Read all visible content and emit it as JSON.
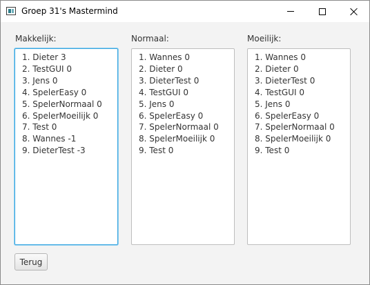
{
  "window": {
    "title": "Groep 31's Mastermind"
  },
  "columns": [
    {
      "label": "Makkelijk:",
      "entries": [
        "1. Dieter 3",
        "2. TestGUI 0",
        "3. Jens 0",
        "4. SpelerEasy 0",
        "5. SpelerNormaal 0",
        "6. SpelerMoeilijk 0",
        "7. Test 0",
        "8. Wannes -1",
        "9. DieterTest -3"
      ]
    },
    {
      "label": "Normaal:",
      "entries": [
        "1. Wannes 0",
        "2. Dieter 0",
        "3. DieterTest 0",
        "4. TestGUI 0",
        "5. Jens 0",
        "6. SpelerEasy 0",
        "7. SpelerNormaal 0",
        "8. SpelerMoeilijk 0",
        "9. Test 0"
      ]
    },
    {
      "label": "Moeilijk:",
      "entries": [
        "1. Wannes 0",
        "2. Dieter 0",
        "3. DieterTest 0",
        "4. TestGUI 0",
        "5. Jens 0",
        "6. SpelerEasy 0",
        "7. SpelerNormaal 0",
        "8. SpelerMoeilijk 0",
        "9. Test 0"
      ]
    }
  ],
  "back_button": {
    "label": "Terug"
  },
  "colors": {
    "focus_border": "#3aa6e0",
    "window_bg": "#f3f3f3"
  },
  "icons": [
    "app-icon",
    "minimize-icon",
    "maximize-icon",
    "close-icon"
  ]
}
